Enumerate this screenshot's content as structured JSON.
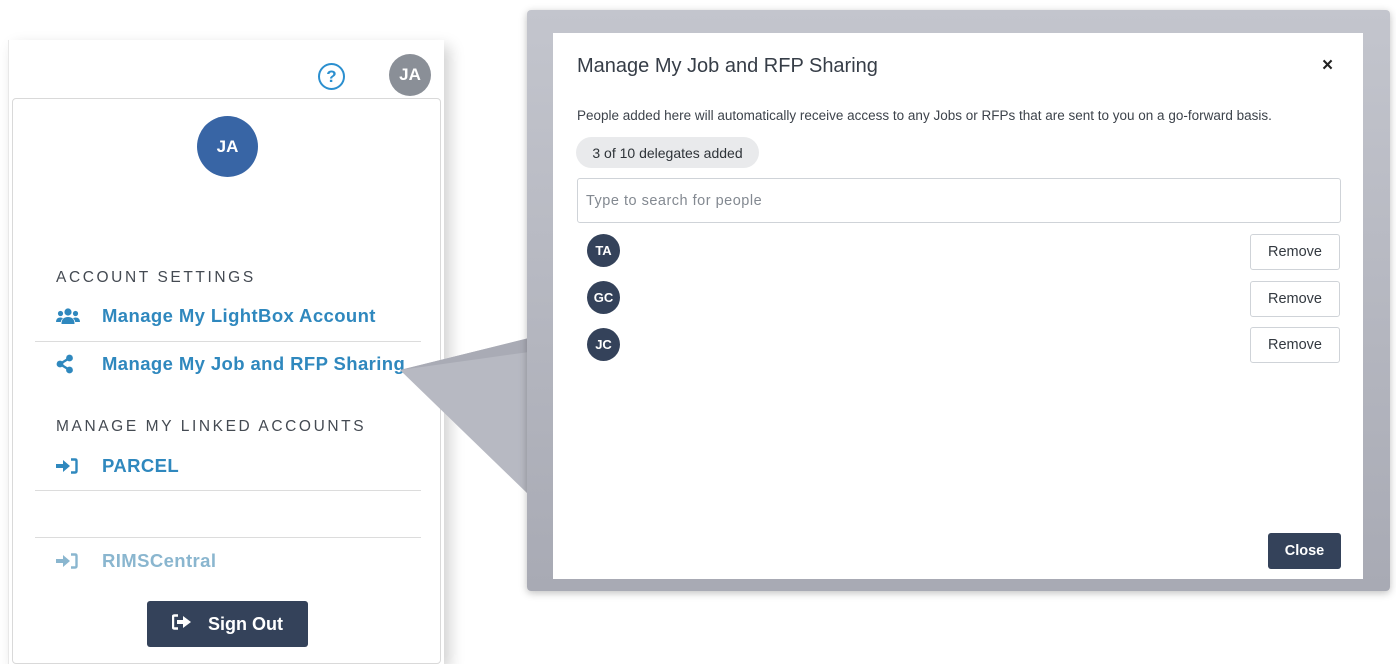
{
  "header": {
    "help_label": "?",
    "user_initials": "JA"
  },
  "account_menu": {
    "user_initials": "JA",
    "account_settings_title": "ACCOUNT SETTINGS",
    "items": [
      {
        "label": "Manage My LightBox Account",
        "icon": "users-icon"
      },
      {
        "label": "Manage My Job and RFP Sharing",
        "icon": "share-icon"
      }
    ],
    "linked_accounts_title": "MANAGE MY LINKED ACCOUNTS",
    "linked_accounts": [
      {
        "label": "PARCEL",
        "icon": "sign-in-icon",
        "enabled": true
      },
      {
        "label": "RIMSCentral",
        "icon": "sign-in-icon",
        "enabled": false
      }
    ],
    "sign_out_label": "Sign Out"
  },
  "modal": {
    "title": "Manage My Job and RFP Sharing",
    "close_x": "×",
    "description": "People added here will automatically receive access to any Jobs or RFPs that are sent to you on a go-forward basis.",
    "delegate_count": "3 of 10 delegates added",
    "search_placeholder": "Type to search for people",
    "delegates": [
      {
        "initials": "TA",
        "action_label": "Remove"
      },
      {
        "initials": "GC",
        "action_label": "Remove"
      },
      {
        "initials": "JC",
        "action_label": "Remove"
      }
    ],
    "close_label": "Close"
  },
  "colors": {
    "accent_blue": "#2f88be",
    "navy": "#34425a",
    "avatar_blue": "#3865a5",
    "avatar_gray": "#8a8f97"
  }
}
